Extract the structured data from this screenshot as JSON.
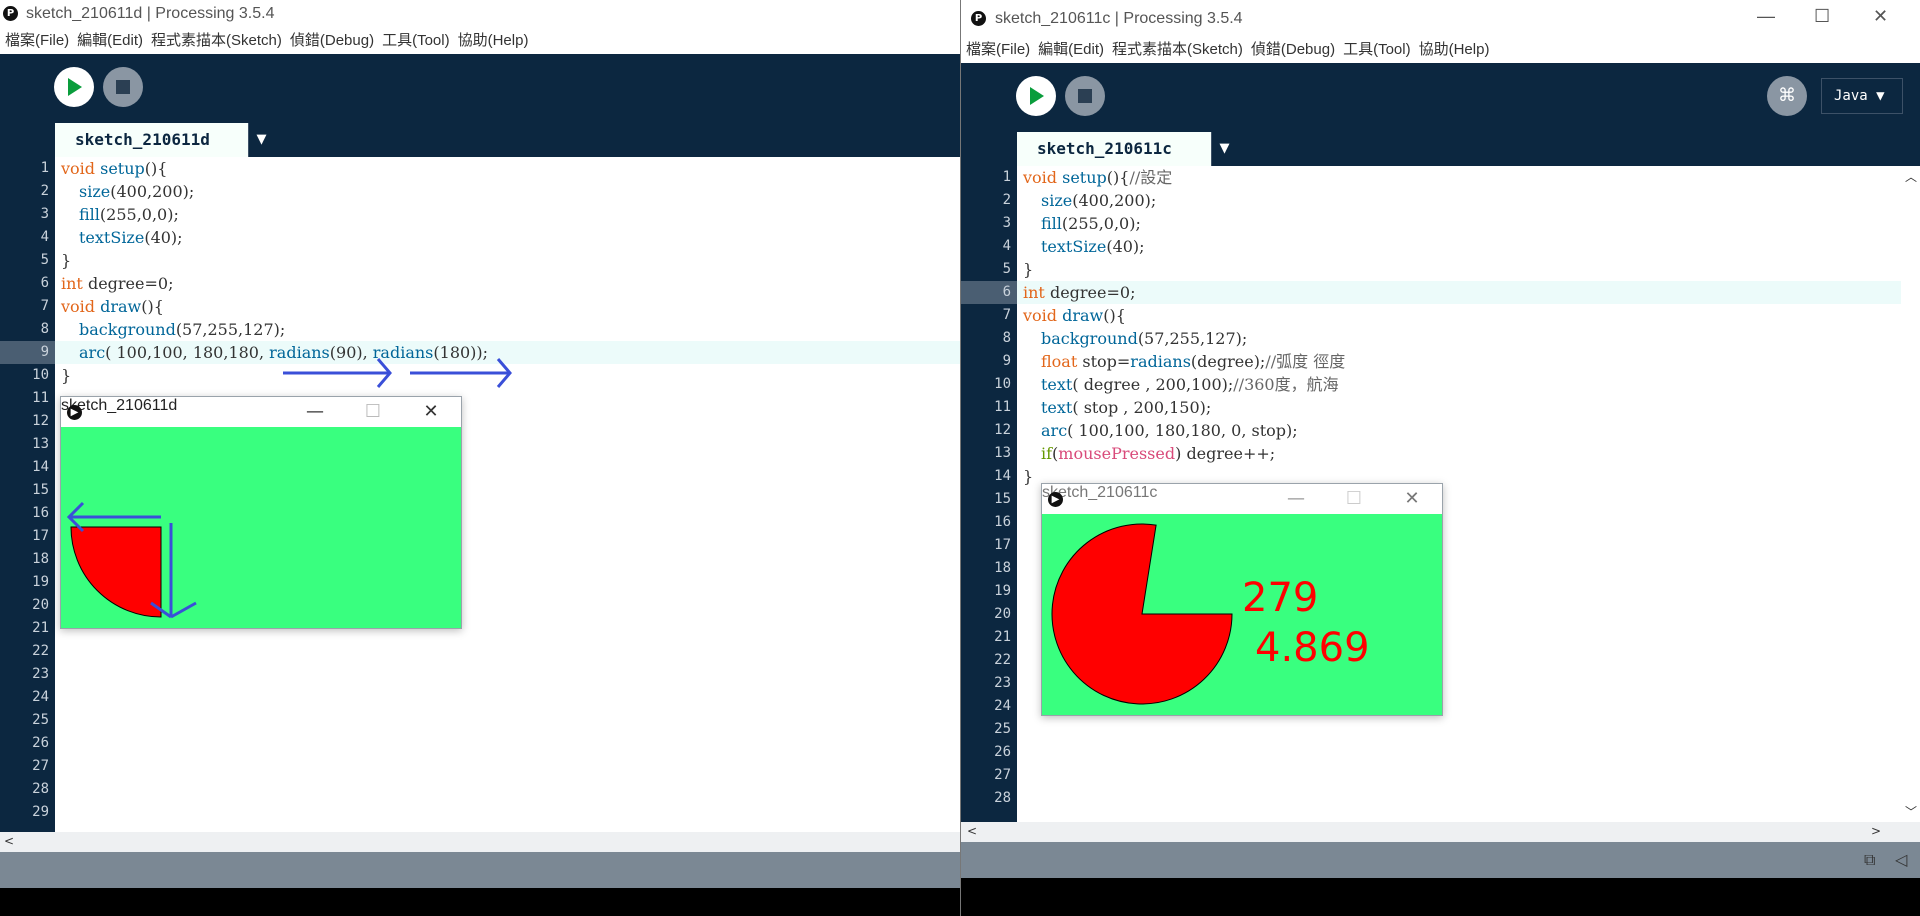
{
  "left_window": {
    "title": "sketch_210611d | Processing 3.5.4",
    "menu": [
      "檔案(File)",
      "編輯(Edit)",
      "程式素描本(Sketch)",
      "偵錯(Debug)",
      "工具(Tool)",
      "協助(Help)"
    ],
    "tab": "sketch_210611d",
    "tab_arrow": "▼",
    "line_numbers": [
      "1",
      "2",
      "3",
      "4",
      "5",
      "6",
      "7",
      "8",
      "9",
      "10",
      "11",
      "12",
      "13",
      "14",
      "15",
      "16",
      "17",
      "18",
      "19",
      "20",
      "21",
      "22",
      "23",
      "24",
      "25",
      "26",
      "27",
      "28",
      "29"
    ],
    "code": {
      "l1a": "void",
      "l1b": " ",
      "l1c": "setup",
      "l1d": "(){",
      "l2a": "size",
      "l2b": "(400,200);",
      "l3a": "fill",
      "l3b": "(255,0,0);",
      "l4a": "textSize",
      "l4b": "(40);",
      "l5": "}",
      "l6a": "int",
      "l6b": " degree=0;",
      "l7a": "void",
      "l7b": " ",
      "l7c": "draw",
      "l7d": "(){",
      "l8a": "background",
      "l8b": "(57,255,127);",
      "l9a": "arc",
      "l9b": "( 100,100, 180,180, ",
      "l9c": "radians",
      "l9d": "(90), ",
      "l9e": "radians",
      "l9f": "(180));",
      "l10": "}"
    },
    "sketch_window": {
      "title": "sketch_210611d"
    },
    "scroll_left": "<"
  },
  "right_window": {
    "title": "sketch_210611c | Processing 3.5.4",
    "menu": [
      "檔案(File)",
      "編輯(Edit)",
      "程式素描本(Sketch)",
      "偵錯(Debug)",
      "工具(Tool)",
      "協助(Help)"
    ],
    "tab": "sketch_210611c",
    "tab_arrow": "▼",
    "mode": "Java ▼",
    "line_numbers": [
      "1",
      "2",
      "3",
      "4",
      "5",
      "6",
      "7",
      "8",
      "9",
      "10",
      "11",
      "12",
      "13",
      "14",
      "15",
      "16",
      "17",
      "18",
      "19",
      "20",
      "21",
      "22",
      "23",
      "24",
      "25",
      "26",
      "27",
      "28"
    ],
    "code": {
      "l1a": "void",
      "l1b": " ",
      "l1c": "setup",
      "l1d": "(){",
      "l1e": "//設定",
      "l2a": "size",
      "l2b": "(400,200);",
      "l3a": "fill",
      "l3b": "(255,0,0);",
      "l4a": "textSize",
      "l4b": "(40);",
      "l5": "}",
      "l6a": "int",
      "l6b": " degree=0;",
      "l7a": "void",
      "l7b": " ",
      "l7c": "draw",
      "l7d": "(){",
      "l8a": "background",
      "l8b": "(57,255,127);",
      "l9a": "float",
      "l9b": " stop=",
      "l9c": "radians",
      "l9d": "(degree);",
      "l9e": "//弧度 徑度",
      "l10a": "text",
      "l10b": "( degree , 200,100);",
      "l10c": "//360度，航海",
      "l11a": "text",
      "l11b": "( stop , 200,150);",
      "l12a": "arc",
      "l12b": "( 100,100, 180,180, 0, stop);",
      "l13a": "if",
      "l13b": "(",
      "l13c": "mousePressed",
      "l13d": ") degree++;",
      "l14": "}"
    },
    "sketch_window": {
      "title": "sketch_210611c",
      "value_degree": "279",
      "value_stop": "4.869"
    },
    "scroll_left": "<",
    "scroll_right": ">"
  },
  "colors": {
    "editor_bg": "#0c2740",
    "canvas_bg": "#39ff7f",
    "arc_fill": "#ff0000",
    "annotation_arrow": "#3a4fd8"
  }
}
